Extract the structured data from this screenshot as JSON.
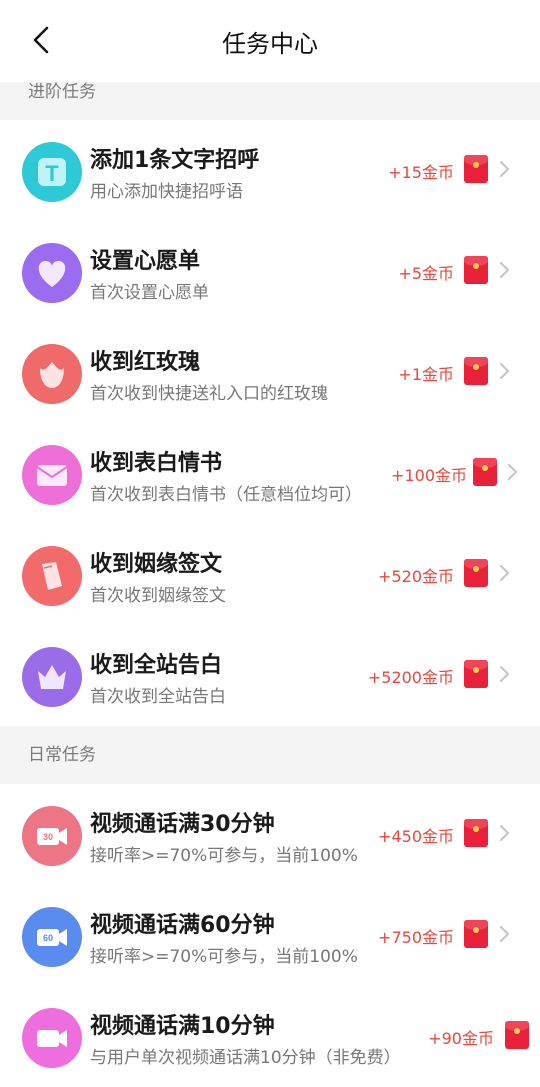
{
  "header": {
    "title": "任务中心"
  },
  "sections": {
    "advanced": "进阶任务",
    "daily": "日常任务"
  },
  "advanced_tasks": [
    {
      "name": "添加1条文字招呼",
      "desc": "用心添加快捷招呼语",
      "reward": "+15金币",
      "icon": "text-t-icon",
      "color": "#2ec9d6"
    },
    {
      "name": "设置心愿单",
      "desc": "首次设置心愿单",
      "reward": "+5金币",
      "icon": "heart-icon",
      "color": "#9b6bf0"
    },
    {
      "name": "收到红玫瑰",
      "desc": "首次收到快捷送礼入口的红玫瑰",
      "reward": "+1金币",
      "icon": "rose-icon",
      "color": "#f06a6a"
    },
    {
      "name": "收到表白情书",
      "desc": "首次收到表白情书（任意档位均可）",
      "reward": "+100金币",
      "icon": "envelope-letter-icon",
      "color": "#ef6fd8"
    },
    {
      "name": "收到姻缘签文",
      "desc": "首次收到姻缘签文",
      "reward": "+520金币",
      "icon": "fortune-slip-icon",
      "color": "#f26a6a"
    },
    {
      "name": "收到全站告白",
      "desc": "首次收到全站告白",
      "reward": "+5200金币",
      "icon": "crown-icon",
      "color": "#9a6ce8"
    }
  ],
  "daily_tasks": [
    {
      "name": "视频通话满30分钟",
      "desc": "接听率>=70%可参与，当前100%",
      "reward": "+450金币",
      "icon": "video-call-30-icon",
      "color": "#ee7585",
      "badge": "30"
    },
    {
      "name": "视频通话满60分钟",
      "desc": "接听率>=70%可参与，当前100%",
      "reward": "+750金币",
      "icon": "video-call-60-icon",
      "color": "#5a8cf0",
      "badge": "60"
    },
    {
      "name": "视频通话满10分钟",
      "desc": "与用户单次视频通话满10分钟（非免费）",
      "reward": "+90金币",
      "icon": "video-call-icon",
      "color": "#ee6ee0"
    }
  ]
}
